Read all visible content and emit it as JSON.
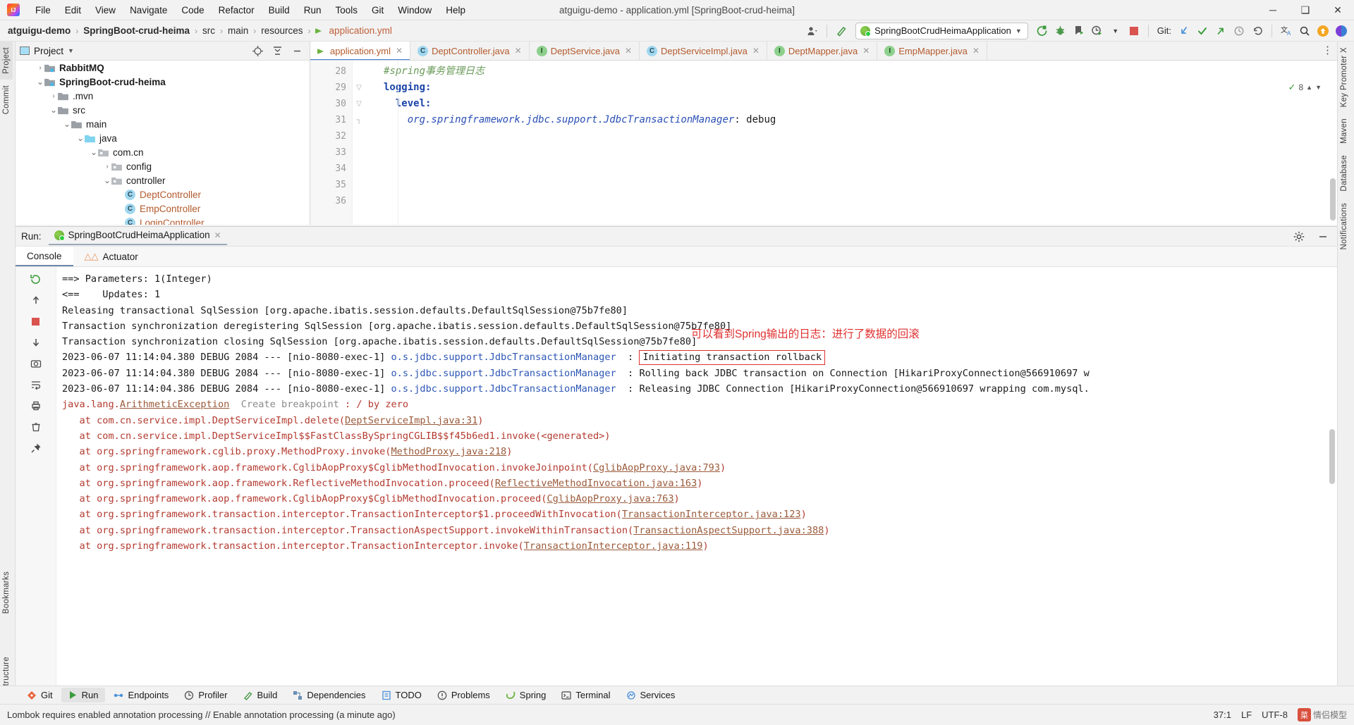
{
  "titlebar": {
    "window_title": "atguigu-demo - application.yml [SpringBoot-crud-heima]",
    "menus": [
      "File",
      "Edit",
      "View",
      "Navigate",
      "Code",
      "Refactor",
      "Build",
      "Run",
      "Tools",
      "Git",
      "Window",
      "Help"
    ],
    "minimize": "─",
    "maximize": "❑",
    "close": "✕"
  },
  "navbar": {
    "crumbs": [
      "atguigu-demo",
      "SpringBoot-crud-heima",
      "src",
      "main",
      "resources",
      "application.yml"
    ],
    "separator": "›",
    "run_config": "SpringBootCrudHeimaApplication",
    "git_label": "Git:"
  },
  "left_strip": {
    "tabs": [
      "Project",
      "Commit",
      "Bookmarks",
      "Structure"
    ]
  },
  "right_strip": {
    "tabs": [
      "Key Promoter X",
      "Maven",
      "Database",
      "Notifications"
    ]
  },
  "project": {
    "header_title": "Project",
    "tree": [
      {
        "indent": 1,
        "arrow": "›",
        "type": "module",
        "label": "RabbitMQ",
        "bold": true
      },
      {
        "indent": 1,
        "arrow": "⌄",
        "type": "module",
        "label": "SpringBoot-crud-heima",
        "bold": true
      },
      {
        "indent": 2,
        "arrow": "›",
        "type": "folder",
        "label": ".mvn",
        "bold": false
      },
      {
        "indent": 2,
        "arrow": "⌄",
        "type": "folder",
        "label": "src",
        "bold": false
      },
      {
        "indent": 3,
        "arrow": "⌄",
        "type": "folder",
        "label": "main",
        "bold": false
      },
      {
        "indent": 4,
        "arrow": "⌄",
        "type": "source",
        "label": "java",
        "bold": false
      },
      {
        "indent": 5,
        "arrow": "⌄",
        "type": "package",
        "label": "com.cn",
        "bold": false
      },
      {
        "indent": 6,
        "arrow": "›",
        "type": "package",
        "label": "config",
        "bold": false
      },
      {
        "indent": 6,
        "arrow": "⌄",
        "type": "package",
        "label": "controller",
        "bold": false
      },
      {
        "indent": 7,
        "arrow": "",
        "type": "class",
        "label": "DeptController",
        "bold": false
      },
      {
        "indent": 7,
        "arrow": "",
        "type": "class",
        "label": "EmpController",
        "bold": false
      },
      {
        "indent": 7,
        "arrow": "",
        "type": "class",
        "label": "LoginController",
        "bold": false
      }
    ]
  },
  "editor": {
    "tabs": [
      {
        "label": "application.yml",
        "icon": "yml-icon",
        "active": true
      },
      {
        "label": "DeptController.java",
        "icon": "class-icon",
        "active": false
      },
      {
        "label": "DeptService.java",
        "icon": "interface-icon",
        "active": false
      },
      {
        "label": "DeptServiceImpl.java",
        "icon": "class-icon",
        "active": false
      },
      {
        "label": "DeptMapper.java",
        "icon": "interface-icon",
        "active": false
      },
      {
        "label": "EmpMapper.java",
        "icon": "interface-icon",
        "active": false
      }
    ],
    "inspection_count": "8",
    "lines": [
      {
        "num": "28",
        "fold": "",
        "kind": "comment",
        "text": "#spring事务管理日志"
      },
      {
        "num": "29",
        "fold": "▽",
        "kind": "key",
        "text": "logging:"
      },
      {
        "num": "30",
        "fold": "▽",
        "kind": "key",
        "indent": 2,
        "text": "level:"
      },
      {
        "num": "31",
        "fold": "┐",
        "kind": "prop",
        "indent": 4,
        "key": "org.springframework.jdbc.support.JdbcTransactionManager",
        "value": ": debug"
      },
      {
        "num": "32",
        "fold": "",
        "kind": "blank",
        "text": ""
      },
      {
        "num": "33",
        "fold": "",
        "kind": "blank",
        "text": ""
      },
      {
        "num": "34",
        "fold": "",
        "kind": "blank",
        "text": ""
      },
      {
        "num": "35",
        "fold": "",
        "kind": "blank",
        "text": ""
      },
      {
        "num": "36",
        "fold": "",
        "kind": "blank",
        "text": ""
      }
    ]
  },
  "run_window": {
    "run_label": "Run:",
    "tab_label": "SpringBootCrudHeimaApplication",
    "close_glyph": "✕",
    "subtabs": [
      {
        "label": "Console",
        "active": true
      },
      {
        "label": "Actuator",
        "active": false
      }
    ],
    "annotation": "可以看到Spring输出的日志：进行了数据的回滚",
    "annotation_color": "#e03030",
    "highlight_color": "#e03030",
    "lines": [
      {
        "type": "plain",
        "text": "==> Parameters: 1(Integer)"
      },
      {
        "type": "plain",
        "text": "<==    Updates: 1"
      },
      {
        "type": "plain",
        "text": "Releasing transactional SqlSession [org.apache.ibatis.session.defaults.DefaultSqlSession@75b7fe80]"
      },
      {
        "type": "plain",
        "text": "Transaction synchronization deregistering SqlSession [org.apache.ibatis.session.defaults.DefaultSqlSession@75b7fe80]"
      },
      {
        "type": "plain",
        "text": "Transaction synchronization closing SqlSession [org.apache.ibatis.session.defaults.DefaultSqlSession@75b7fe80]"
      },
      {
        "type": "log_highlight",
        "prefix": "2023-06-07 11:14:04.380 DEBUG 2084 --- [nio-8080-exec-1] ",
        "logger": "o.s.jdbc.support.JdbcTransactionManager",
        "mid": "  : ",
        "message": "Initiating transaction rollback"
      },
      {
        "type": "log",
        "prefix": "2023-06-07 11:14:04.380 DEBUG 2084 --- [nio-8080-exec-1] ",
        "logger": "o.s.jdbc.support.JdbcTransactionManager",
        "mid": "  : ",
        "message": "Rolling back JDBC transaction on Connection [HikariProxyConnection@566910697 w"
      },
      {
        "type": "log",
        "prefix": "2023-06-07 11:14:04.386 DEBUG 2084 --- [nio-8080-exec-1] ",
        "logger": "o.s.jdbc.support.JdbcTransactionManager",
        "mid": "  : ",
        "message": "Releasing JDBC Connection [HikariProxyConnection@566910697 wrapping com.mysql."
      },
      {
        "type": "exception",
        "text": "java.lang.ArithmeticException",
        "note": "Create breakpoint",
        "tail": " : / by zero"
      },
      {
        "type": "stack",
        "pre": "   at com.cn.service.impl.DeptServiceImpl.delete(",
        "link": "DeptServiceImpl.java:31",
        "post": ")"
      },
      {
        "type": "stack",
        "pre": "   at com.cn.service.impl.DeptServiceImpl$$FastClassBySpringCGLIB$$f45b6ed1.invoke(<generated>)",
        "link": "",
        "post": ""
      },
      {
        "type": "stack",
        "pre": "   at org.springframework.cglib.proxy.MethodProxy.invoke(",
        "link": "MethodProxy.java:218",
        "post": ")"
      },
      {
        "type": "stack",
        "pre": "   at org.springframework.aop.framework.CglibAopProxy$CglibMethodInvocation.invokeJoinpoint(",
        "link": "CglibAopProxy.java:793",
        "post": ")"
      },
      {
        "type": "stack",
        "pre": "   at org.springframework.aop.framework.ReflectiveMethodInvocation.proceed(",
        "link": "ReflectiveMethodInvocation.java:163",
        "post": ")"
      },
      {
        "type": "stack",
        "pre": "   at org.springframework.aop.framework.CglibAopProxy$CglibMethodInvocation.proceed(",
        "link": "CglibAopProxy.java:763",
        "post": ")"
      },
      {
        "type": "stack",
        "pre": "   at org.springframework.transaction.interceptor.TransactionInterceptor$1.proceedWithInvocation(",
        "link": "TransactionInterceptor.java:123",
        "post": ")"
      },
      {
        "type": "stack",
        "pre": "   at org.springframework.transaction.interceptor.TransactionAspectSupport.invokeWithinTransaction(",
        "link": "TransactionAspectSupport.java:388",
        "post": ")"
      },
      {
        "type": "stack",
        "pre": "   at org.springframework.transaction.interceptor.TransactionInterceptor.invoke(",
        "link": "TransactionInterceptor.java:119",
        "post": ")"
      }
    ]
  },
  "bottom_tabs": [
    {
      "label": "Git",
      "icon": "git-icon",
      "active": false
    },
    {
      "label": "Run",
      "icon": "run-icon",
      "active": true
    },
    {
      "label": "Endpoints",
      "icon": "endpoints-icon",
      "active": false
    },
    {
      "label": "Profiler",
      "icon": "profiler-icon",
      "active": false
    },
    {
      "label": "Build",
      "icon": "build-icon",
      "active": false
    },
    {
      "label": "Dependencies",
      "icon": "dependencies-icon",
      "active": false
    },
    {
      "label": "TODO",
      "icon": "todo-icon",
      "active": false
    },
    {
      "label": "Problems",
      "icon": "problems-icon",
      "active": false
    },
    {
      "label": "Spring",
      "icon": "spring-icon",
      "active": false
    },
    {
      "label": "Terminal",
      "icon": "terminal-icon",
      "active": false
    },
    {
      "label": "Services",
      "icon": "services-icon",
      "active": false
    }
  ],
  "statusbar": {
    "message": "Lombok requires enabled annotation processing // Enable annotation processing (a minute ago)",
    "caret": "37:1",
    "line_sep": "LF",
    "encoding": "UTF-8",
    "watermark": "菜",
    "watermark_text": "情侣模型"
  }
}
